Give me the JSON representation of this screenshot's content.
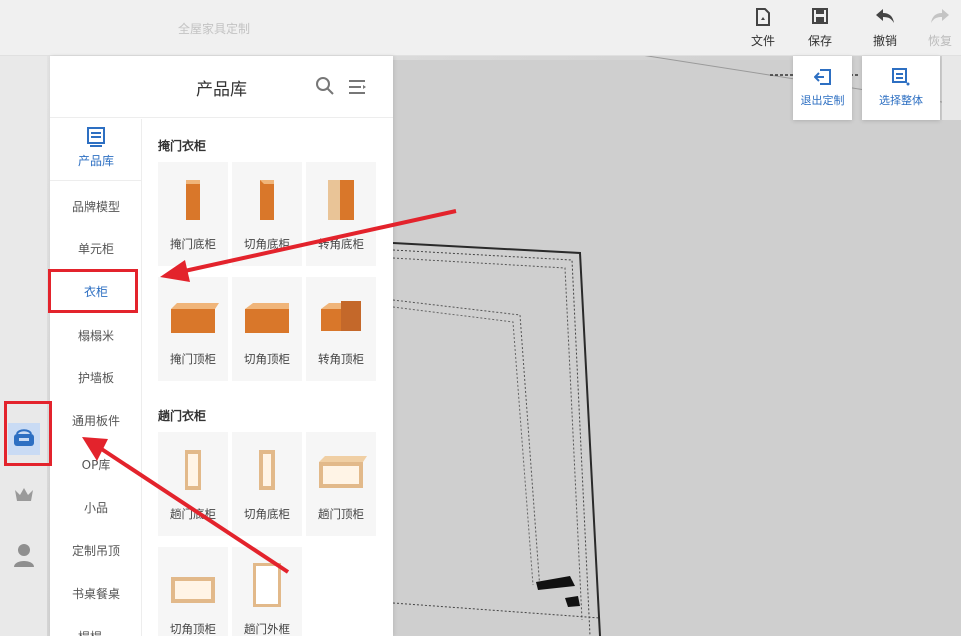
{
  "colors": {
    "accent": "#2d6fc2",
    "annotation_red": "#e3232c",
    "wood": "#d9772a"
  },
  "topbar": {
    "scene_title": "全屋家具定制",
    "tools": [
      {
        "label": "文件",
        "icon": "file-icon",
        "enabled": true
      },
      {
        "label": "保存",
        "icon": "save-icon",
        "enabled": true
      },
      {
        "label": "撤销",
        "icon": "undo-icon",
        "enabled": true
      },
      {
        "label": "恢复",
        "icon": "redo-icon",
        "enabled": false
      }
    ]
  },
  "float_actions": {
    "exit_custom": "退出定制",
    "select_whole": "选择整体"
  },
  "panel": {
    "title": "产品库",
    "category_header": "产品库",
    "categories": [
      "品牌模型",
      "单元柜",
      "衣柜",
      "榻榻米",
      "护墙板",
      "通用板件",
      "OP库",
      "小品",
      "定制吊顶",
      "书桌餐桌",
      "榻榻…"
    ],
    "active_category": "衣柜",
    "sections": [
      {
        "title": "掩门衣柜",
        "items": [
          "掩门底柜",
          "切角底柜",
          "转角底柜",
          "掩门顶柜",
          "切角顶柜",
          "转角顶柜"
        ]
      },
      {
        "title": "趟门衣柜",
        "items": [
          "趟门底柜",
          "切角底柜",
          "趟门顶柜",
          "切角顶柜",
          "趟门外框"
        ]
      }
    ]
  },
  "rail": {
    "icons": [
      "product-library-icon",
      "crown-icon",
      "user-icon"
    ],
    "active": "product-library-icon"
  }
}
